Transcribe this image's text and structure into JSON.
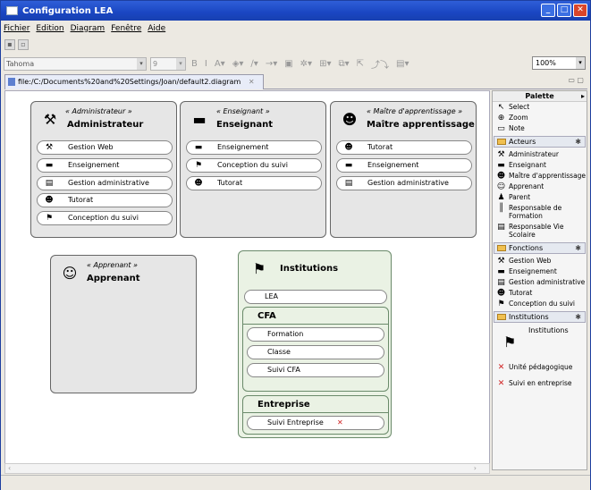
{
  "window": {
    "title": "Configuration LEA",
    "min": "_",
    "max": "□",
    "close": "✕"
  },
  "menu": [
    "Fichier",
    "Edition",
    "Diagram",
    "Fenêtre",
    "Aide"
  ],
  "toolbar": {
    "font": "Tahoma",
    "size": "9",
    "zoom": "100%"
  },
  "tab": {
    "title": "file:/C:/Documents%20and%20Settings/Joan/default2.diagram",
    "close": "✕"
  },
  "boxes": {
    "administrateur": {
      "stereotype": "« Administrateur »",
      "name": "Administrateur",
      "icon": "tools-icon",
      "items": [
        "Gestion Web",
        "Enseignement",
        "Gestion administrative",
        "Tutorat",
        "Conception du suivi"
      ]
    },
    "enseignant": {
      "stereotype": "« Enseignant »",
      "name": "Enseignant",
      "icon": "blackboard-icon",
      "items": [
        "Enseignement",
        "Conception du suivi",
        "Tutorat"
      ]
    },
    "maitre": {
      "stereotype": "« Maître d'apprentissage »",
      "name": "Maître apprentissage",
      "icon": "mentor-icon",
      "items": [
        "Tutorat",
        "Enseignement",
        "Gestion administrative"
      ]
    },
    "apprenant": {
      "stereotype": "« Apprenant »",
      "name": "Apprenant",
      "icon": "learner-icon"
    },
    "institutions": {
      "name": "Institutions",
      "icon": "flag-icon",
      "lea": "LEA",
      "cfa": {
        "title": "CFA",
        "items": [
          "Formation",
          "Classe",
          "Suivi CFA"
        ]
      },
      "entreprise": {
        "title": "Entreprise",
        "items": [
          "Suivi Entreprise"
        ]
      }
    }
  },
  "palette": {
    "title": "Palette",
    "tools": [
      "Select",
      "Zoom",
      "Note"
    ],
    "acteurs": {
      "label": "Acteurs",
      "items": [
        "Administrateur",
        "Enseignant",
        "Maître d'apprentissage",
        "Apprenant",
        "Parent",
        "Responsable de Formation",
        "Responsable Vie Scolaire"
      ]
    },
    "fonctions": {
      "label": "Fonctions",
      "items": [
        "Gestion Web",
        "Enseignement",
        "Gestion administrative",
        "Tutorat",
        "Conception du suivi"
      ]
    },
    "institutions": {
      "label": "Institutions",
      "big": "Institutions",
      "items": [
        "Unité pédagogique",
        "Suivi en entreprise"
      ]
    }
  },
  "colors": {
    "title_bar": "#1a46c2",
    "box_gray": "#e6e6e6",
    "box_green": "#eaf2e4",
    "error_x": "#d02020"
  }
}
